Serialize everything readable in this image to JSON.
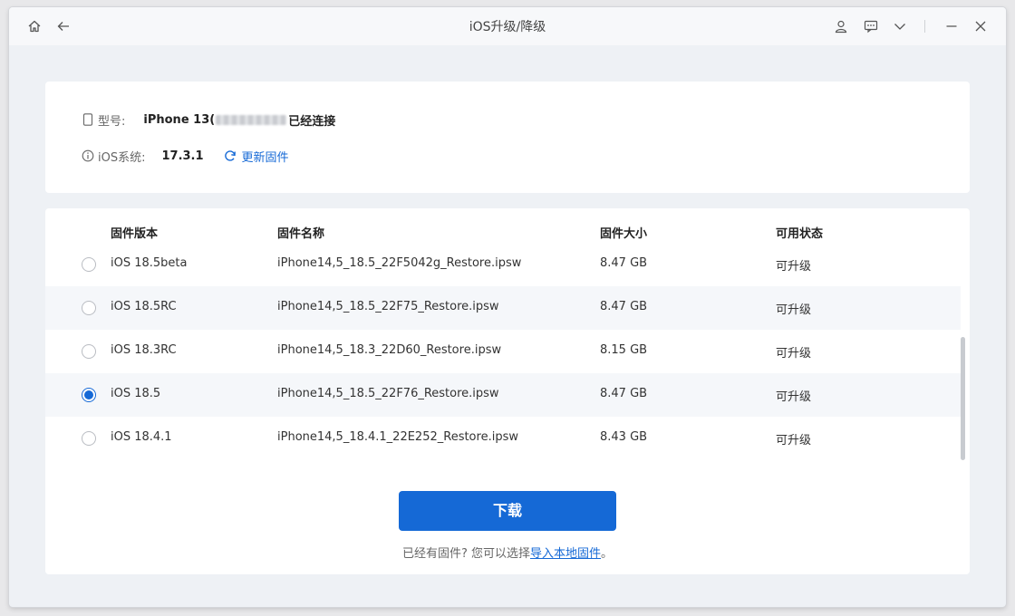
{
  "window": {
    "title": "iOS升级/降级",
    "icons": [
      "home-icon",
      "back-icon",
      "user-icon",
      "feedback-icon",
      "chevron-down-icon",
      "minimize-icon",
      "close-icon"
    ]
  },
  "device": {
    "model_label": "型号:",
    "model_value": "iPhone 13(",
    "connected_text": "已经连接",
    "ios_label": "iOS系统:",
    "ios_value": "17.3.1",
    "update_link": "更新固件"
  },
  "table": {
    "headers": [
      "固件版本",
      "固件名称",
      "固件大小",
      "可用状态"
    ],
    "rows": [
      {
        "version": "iOS 18.5beta",
        "name": "iPhone14,5_18.5_22F5042g_Restore.ipsw",
        "size": "8.47 GB",
        "status": "可升级",
        "selected": false
      },
      {
        "version": "iOS 18.5RC",
        "name": "iPhone14,5_18.5_22F75_Restore.ipsw",
        "size": "8.47 GB",
        "status": "可升级",
        "selected": false
      },
      {
        "version": "iOS 18.3RC",
        "name": "iPhone14,5_18.3_22D60_Restore.ipsw",
        "size": "8.15 GB",
        "status": "可升级",
        "selected": false
      },
      {
        "version": "iOS 18.5",
        "name": "iPhone14,5_18.5_22F76_Restore.ipsw",
        "size": "8.47 GB",
        "status": "可升级",
        "selected": true
      },
      {
        "version": "iOS 18.4.1",
        "name": "iPhone14,5_18.4.1_22E252_Restore.ipsw",
        "size": "8.43 GB",
        "status": "可升级",
        "selected": false
      }
    ]
  },
  "actions": {
    "download_label": "下载",
    "hint_prefix": "已经有固件? 您可以选择",
    "hint_link": "导入本地固件",
    "hint_suffix": "。"
  },
  "colors": {
    "accent": "#1569d6",
    "row_alt": "#f5f7fa"
  }
}
